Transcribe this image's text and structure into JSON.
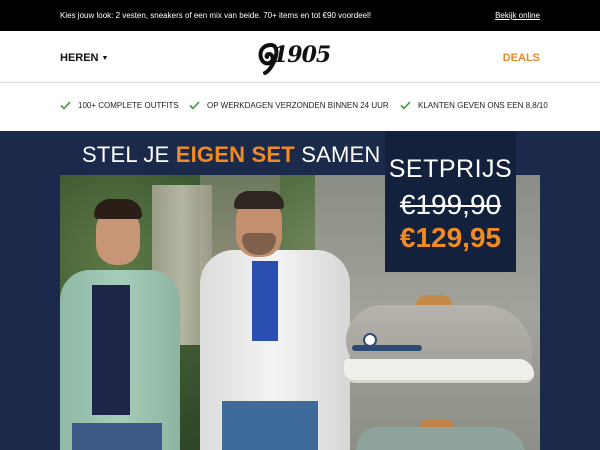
{
  "topbar": {
    "promo_text": "Kies jouw look: 2 vesten, sneakers of een mix van beide. 70+ items en tot €90 voordeel!",
    "view_online": "Bekijk online"
  },
  "header": {
    "menu_label": "HEREN",
    "logo_text": "1905",
    "deals_label": "DEALS"
  },
  "usps": [
    {
      "icon": "check-icon",
      "label": "100+ COMPLETE OUTFITS"
    },
    {
      "icon": "check-icon",
      "label": "OP WERKDAGEN VERZONDEN BINNEN 24 UUR"
    },
    {
      "icon": "check-icon",
      "label": "KLANTEN GEVEN ONS EEN 8,8/10"
    }
  ],
  "hero": {
    "title_part1": "STEL JE ",
    "title_highlight": "EIGEN SET",
    "title_part2": " SAMEN",
    "price_label": "SETPRIJS",
    "price_old": "€199,90",
    "price_new": "€129,95"
  },
  "colors": {
    "accent": "#f08a24",
    "navy": "#1b2a4a",
    "check": "#3a9b3a"
  }
}
